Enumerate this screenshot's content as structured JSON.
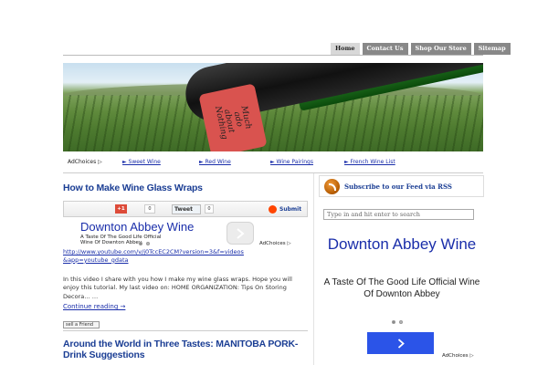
{
  "nav": {
    "tabs": [
      {
        "label": "Home",
        "active": true
      },
      {
        "label": "Contact Us"
      },
      {
        "label": "Shop Our Store"
      },
      {
        "label": "Sitemap"
      }
    ]
  },
  "banner": {
    "bottle_text": "Much\nado\nabout\nNothing"
  },
  "linkbar": {
    "adchoices": "AdChoices ▷",
    "links": [
      "► Sweet Wine",
      "► Red Wine",
      "► Wine Pairings",
      "► French Wine List"
    ]
  },
  "post1": {
    "title": "How to Make Wine Glass Wraps",
    "share": {
      "gplus": "+1",
      "gplus_count": "0",
      "tweet": "Tweet",
      "tweet_count": "0",
      "submit": "Submit"
    },
    "ad": {
      "title": "Downton Abbey Wine",
      "subtitle": "A Taste Of The Good Life Official Wine Of Downton Abbey",
      "adchoices": "AdChoices ▷"
    },
    "link": "http://www.youtube.com/v/j0TccEC2CM?version=3&f=videos&app=youtube_gdata",
    "excerpt": "In this video I share with you how I make my wine glass wraps. Hope you will enjoy this tutorial. My last video on: HOME ORGANIZATION: Tips On Storing Decora… …",
    "continue": "Continue reading →",
    "sell_friend": "sell a Friend"
  },
  "post2": {
    "title": "Around the World in Three Tastes: MANITOBA PORK- Drink Suggestions"
  },
  "sidebar": {
    "rss": "Subscribe to our Feed via RSS",
    "search_placeholder": "Type in and hit enter to search",
    "ad": {
      "title": "Downton Abbey Wine",
      "subtitle": "A Taste Of The Good Life Official Wine Of Downton Abbey",
      "adchoices": "AdChoices ▷"
    }
  },
  "colors": {
    "link": "#1a2eaa",
    "title": "#1b3e94",
    "ad_button": "#2b54e8",
    "nav_tab": "#888888"
  }
}
